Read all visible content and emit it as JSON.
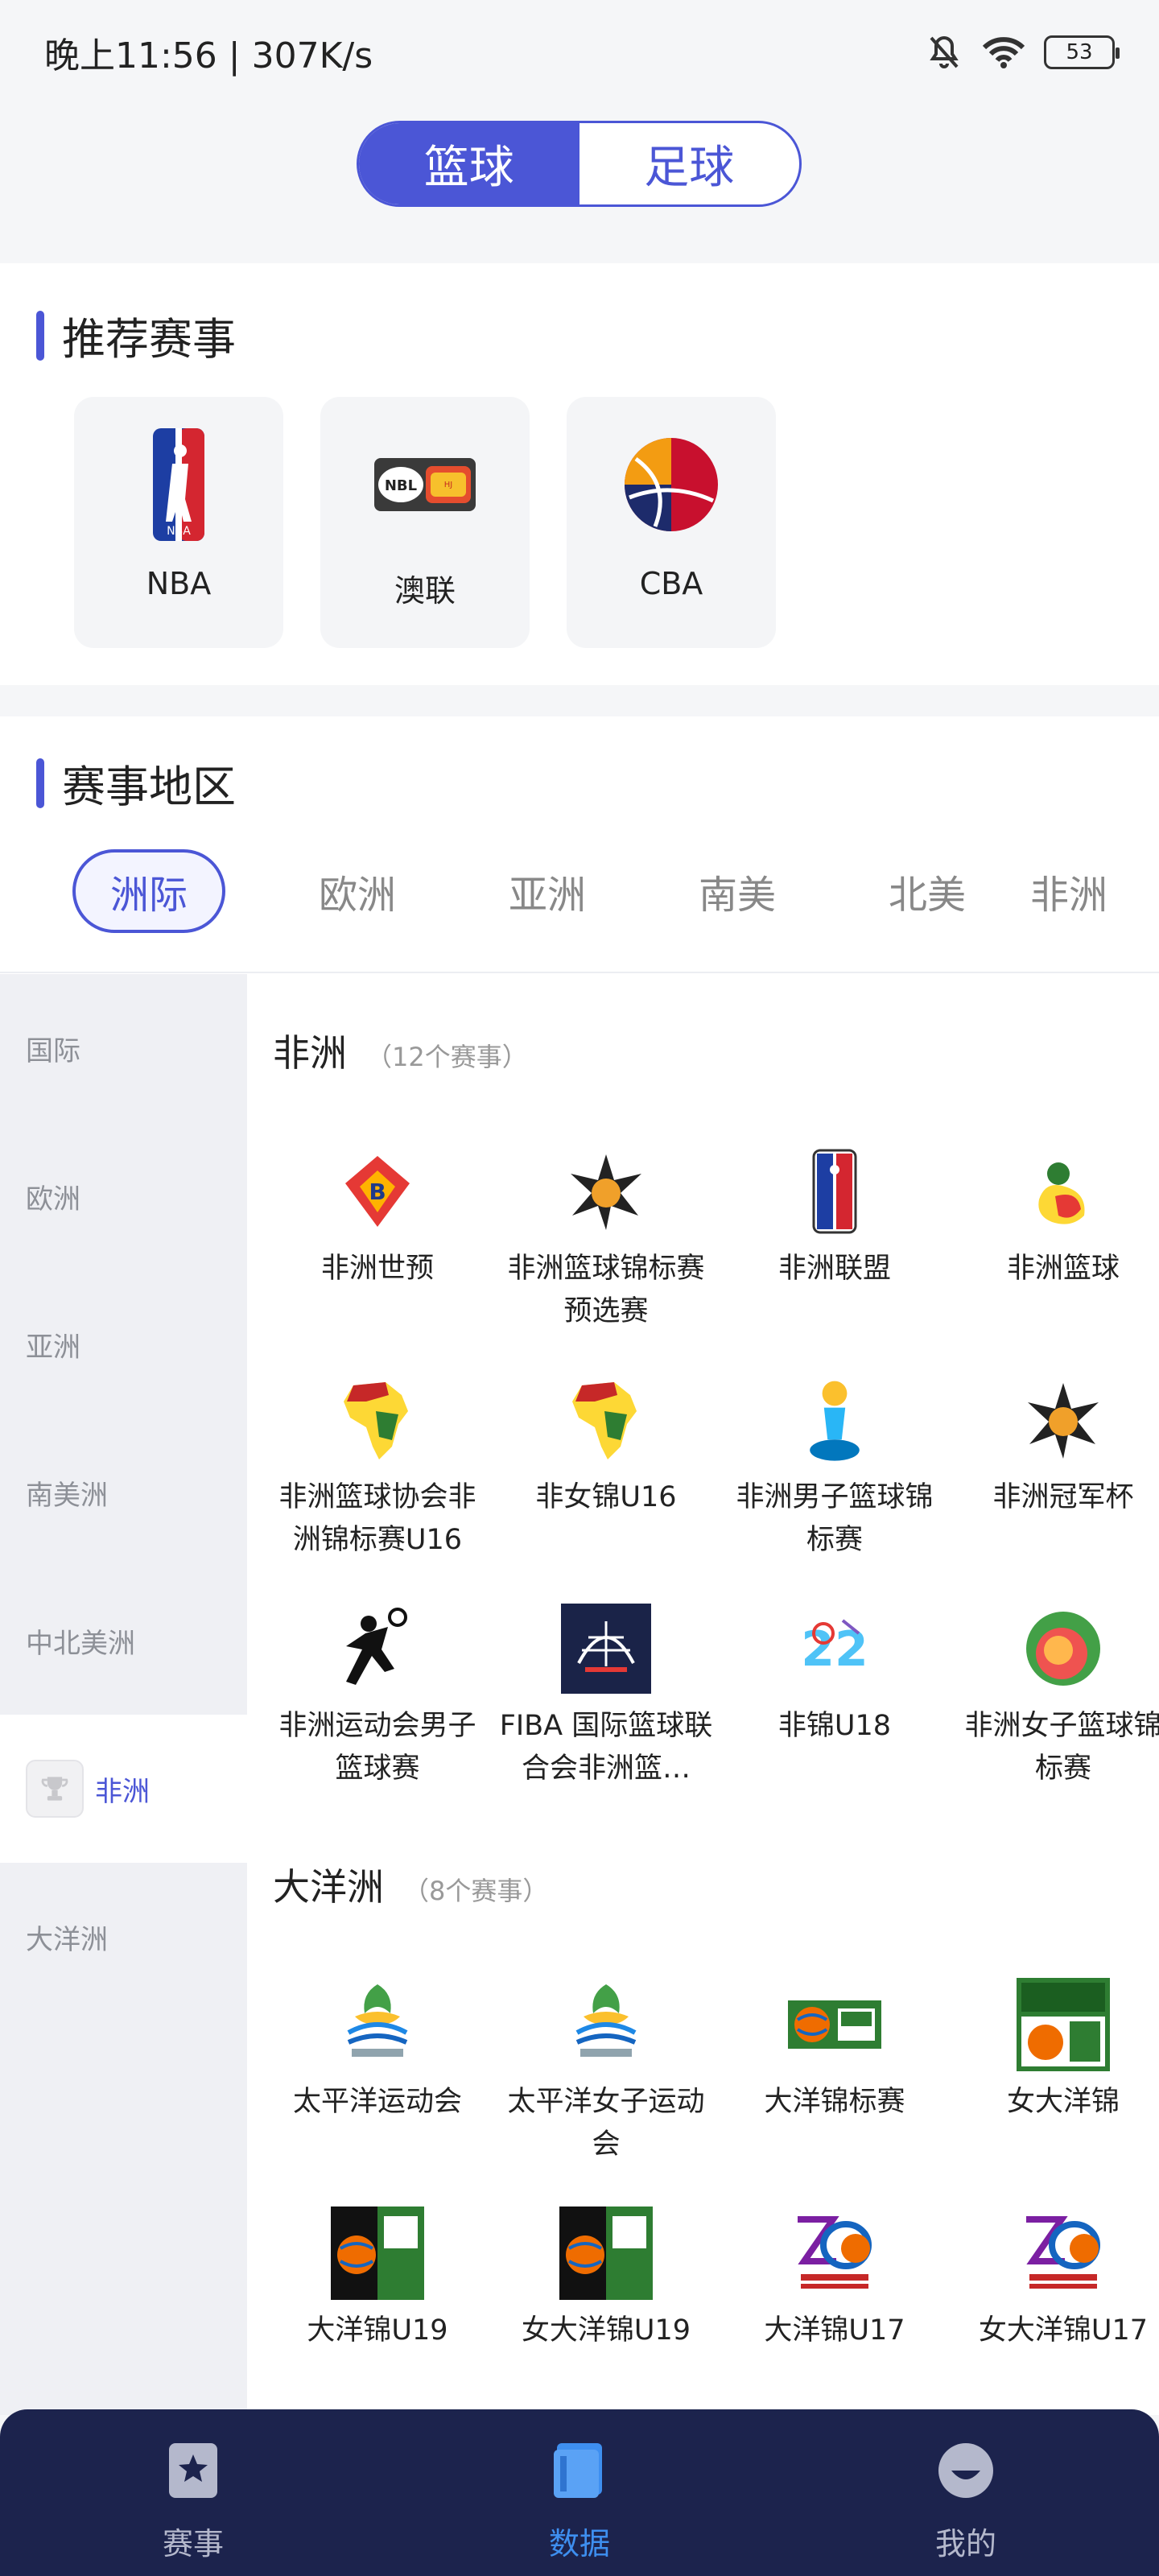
{
  "status": {
    "time": "晚上11:56 | 307K/s",
    "battery": "53"
  },
  "sport_switch": {
    "tabs": [
      "篮球",
      "足球"
    ],
    "active": 0
  },
  "recommend": {
    "title": "推荐赛事",
    "items": [
      {
        "name": "NBA",
        "icon": "nba-logo"
      },
      {
        "name": "澳联",
        "icon": "nbl-logo"
      },
      {
        "name": "CBA",
        "icon": "cba-logo"
      }
    ]
  },
  "region": {
    "title": "赛事地区",
    "tabs": [
      "洲际",
      "欧洲",
      "亚洲",
      "南美",
      "北美",
      "非洲"
    ],
    "active_tab": 0,
    "side_menu": [
      "国际",
      "欧洲",
      "亚洲",
      "南美洲",
      "中北美洲",
      "非洲",
      "大洋洲"
    ],
    "side_active": 5,
    "groups": [
      {
        "name": "非洲",
        "count": "（12个赛事）",
        "items": [
          "非洲世预",
          "非洲篮球锦标赛预选赛",
          "非洲联盟",
          "非洲篮球",
          "非洲篮球协会非洲锦标赛U16",
          "非女锦U16",
          "非洲男子篮球锦标赛",
          "非洲冠军杯",
          "非洲运动会男子篮球赛",
          "FIBA 国际篮球联合会非洲篮…",
          "非锦U18",
          "非洲女子篮球锦标赛"
        ]
      },
      {
        "name": "大洋洲",
        "count": "（8个赛事）",
        "items": [
          "太平洋运动会",
          "太平洋女子运动会",
          "大洋锦标赛",
          "女大洋锦",
          "大洋锦U19",
          "女大洋锦U19",
          "大洋锦U17",
          "女大洋锦U17"
        ]
      }
    ]
  },
  "bottom_nav": {
    "items": [
      {
        "label": "赛事",
        "icon": "bookmark-star-icon"
      },
      {
        "label": "数据",
        "icon": "book-icon"
      },
      {
        "label": "我的",
        "icon": "profile-face-icon"
      }
    ],
    "active": 1
  },
  "colors": {
    "accent": "#4b56d6",
    "nav_bg": "#1c234d",
    "nav_active": "#3e8ff0"
  }
}
